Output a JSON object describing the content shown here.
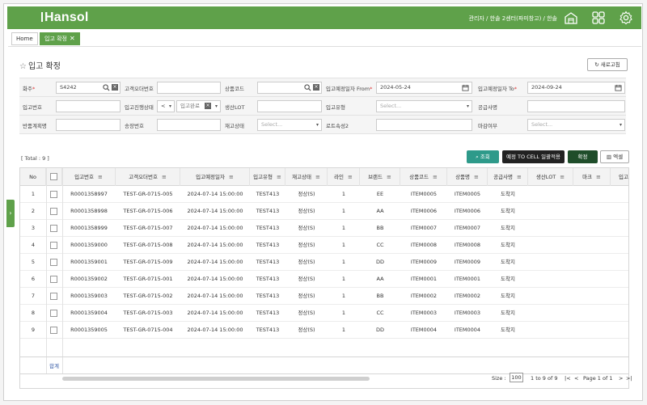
{
  "header": {
    "logo": "Hansol",
    "user_info": "관리자 / 한솔 2센터(파미창고) / 한솔",
    "icons": [
      "warehouse-icon",
      "grid-apps-icon",
      "settings-gear-icon"
    ]
  },
  "tabs": [
    {
      "label": "Home"
    },
    {
      "label": "입고 확정",
      "close": "✕"
    }
  ],
  "page": {
    "title": "입고 확정",
    "star": "☆",
    "refresh_label": "새로고침"
  },
  "form": {
    "row1": {
      "shipper_label": "화주",
      "shipper_value": "S4242",
      "cust_order_label": "고객오더번호",
      "cust_order_value": "",
      "product_label": "상품코드",
      "product_value": "",
      "date_from_label": "입고예정일자 From",
      "date_from_value": "2024-05-24",
      "date_to_label": "입고예정일자 To",
      "date_to_value": "2024-09-24"
    },
    "row2": {
      "inbound_no_label": "입고번호",
      "inbound_no_value": "",
      "progress_label": "입고진행상태",
      "op_value": "<",
      "status_value": "입고완료",
      "lot_label": "생산LOT",
      "lot_value": "",
      "type_label": "입고유형",
      "type_placeholder": "Select...",
      "supplier_label": "공급사명",
      "supplier_value": ""
    },
    "row3": {
      "return_label": "반품계획명",
      "return_value": "",
      "invoice_label": "송장번호",
      "invoice_value": "",
      "stock_label": "재고상태",
      "stock_placeholder": "Select...",
      "lot2_label": "로트속성2",
      "lot2_value": "",
      "deadline_label": "마감여부",
      "deadline_placeholder": "Select..."
    }
  },
  "toolbar": {
    "total": "[ Total : 9 ]",
    "search_label": "조회",
    "cell_label": "예정 TO CELL 일괄적용",
    "confirm_label": "확정",
    "excel_label": "엑셀"
  },
  "grid": {
    "columns": [
      "No",
      "",
      "입고번호",
      "고객오더번호",
      "입고예정일자",
      "입고유형",
      "재고상태",
      "라인",
      "브랜드",
      "상품코드",
      "상품명",
      "공급사명",
      "생산LOT",
      "마크",
      "입고"
    ],
    "rows": [
      [
        "1",
        "R0001358997",
        "TEST-GR-0715-005",
        "2024-07-14 15:00:00",
        "TEST413",
        "정상(S)",
        "1",
        "EE",
        "ITEM0005",
        "ITEM0005",
        "도착지"
      ],
      [
        "2",
        "R0001358998",
        "TEST-GR-0715-006",
        "2024-07-14 15:00:00",
        "TEST413",
        "정상(S)",
        "1",
        "AA",
        "ITEM0006",
        "ITEM0006",
        "도착지"
      ],
      [
        "3",
        "R0001358999",
        "TEST-GR-0715-007",
        "2024-07-14 15:00:00",
        "TEST413",
        "정상(S)",
        "1",
        "BB",
        "ITEM0007",
        "ITEM0007",
        "도착지"
      ],
      [
        "4",
        "R0001359000",
        "TEST-GR-0715-008",
        "2024-07-14 15:00:00",
        "TEST413",
        "정상(S)",
        "1",
        "CC",
        "ITEM0008",
        "ITEM0008",
        "도착지"
      ],
      [
        "5",
        "R0001359001",
        "TEST-GR-0715-009",
        "2024-07-14 15:00:00",
        "TEST413",
        "정상(S)",
        "1",
        "DD",
        "ITEM0009",
        "ITEM0009",
        "도착지"
      ],
      [
        "6",
        "R0001359002",
        "TEST-GR-0715-001",
        "2024-07-14 15:00:00",
        "TEST413",
        "정상(S)",
        "1",
        "AA",
        "ITEM0001",
        "ITEM0001",
        "도착지"
      ],
      [
        "7",
        "R0001359003",
        "TEST-GR-0715-002",
        "2024-07-14 15:00:00",
        "TEST413",
        "정상(S)",
        "1",
        "BB",
        "ITEM0002",
        "ITEM0002",
        "도착지"
      ],
      [
        "8",
        "R0001359004",
        "TEST-GR-0715-003",
        "2024-07-14 15:00:00",
        "TEST413",
        "정상(S)",
        "1",
        "CC",
        "ITEM0003",
        "ITEM0003",
        "도착지"
      ],
      [
        "9",
        "R0001359005",
        "TEST-GR-0715-004",
        "2024-07-14 15:00:00",
        "TEST413",
        "정상(S)",
        "1",
        "DD",
        "ITEM0004",
        "ITEM0004",
        "도착지"
      ]
    ],
    "sum_label": "합계"
  },
  "pager": {
    "size_label": "Size :",
    "size_value": "100",
    "range": "1 to 9 of 9",
    "page_info": "Page 1 of 1",
    "first": "|<",
    "prev": "<",
    "next": ">",
    "last": ">|"
  },
  "colors": {
    "brand": "#5fa14a",
    "search_btn": "#2e9a8a",
    "confirm_btn": "#1f4d2a"
  }
}
